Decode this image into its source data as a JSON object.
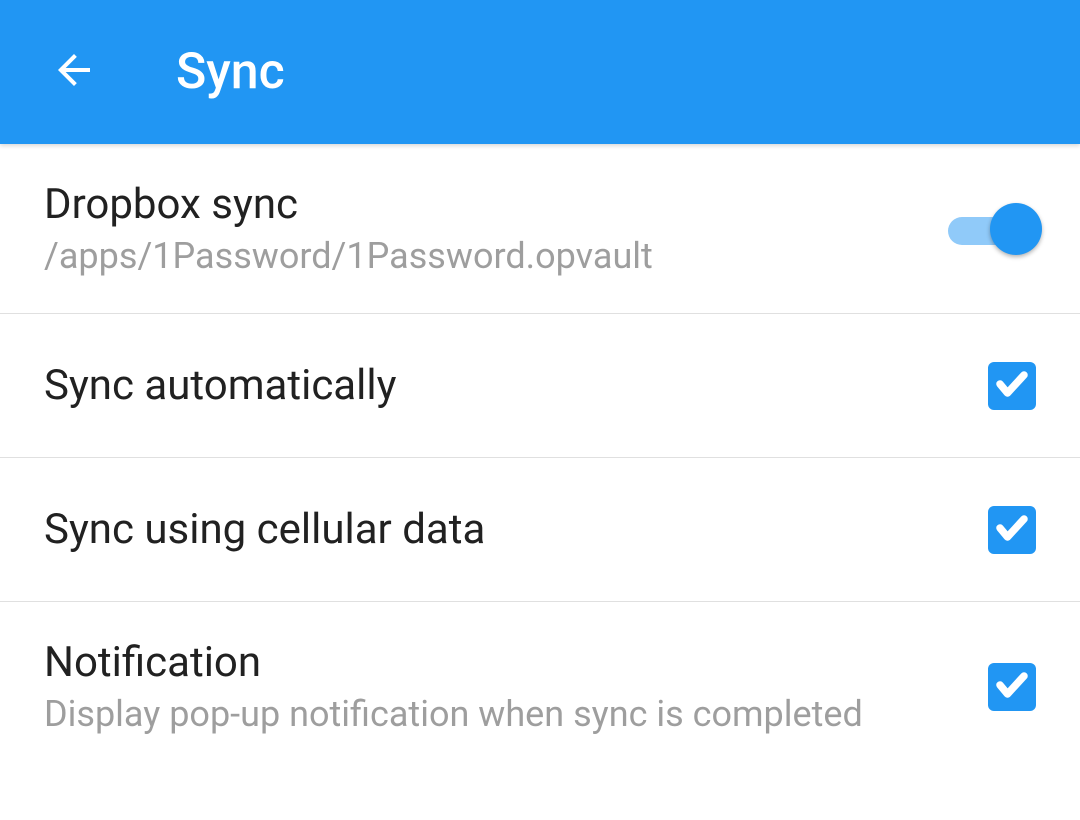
{
  "header": {
    "title": "Sync"
  },
  "items": [
    {
      "title": "Dropbox sync",
      "subtitle": "/apps/1Password/1Password.opvault",
      "control": "switch",
      "enabled": true
    },
    {
      "title": "Sync automatically",
      "subtitle": "",
      "control": "checkbox",
      "enabled": true
    },
    {
      "title": "Sync using cellular data",
      "subtitle": "",
      "control": "checkbox",
      "enabled": true
    },
    {
      "title": "Notification",
      "subtitle": "Display pop-up notification when sync is completed",
      "control": "checkbox",
      "enabled": true
    }
  ]
}
